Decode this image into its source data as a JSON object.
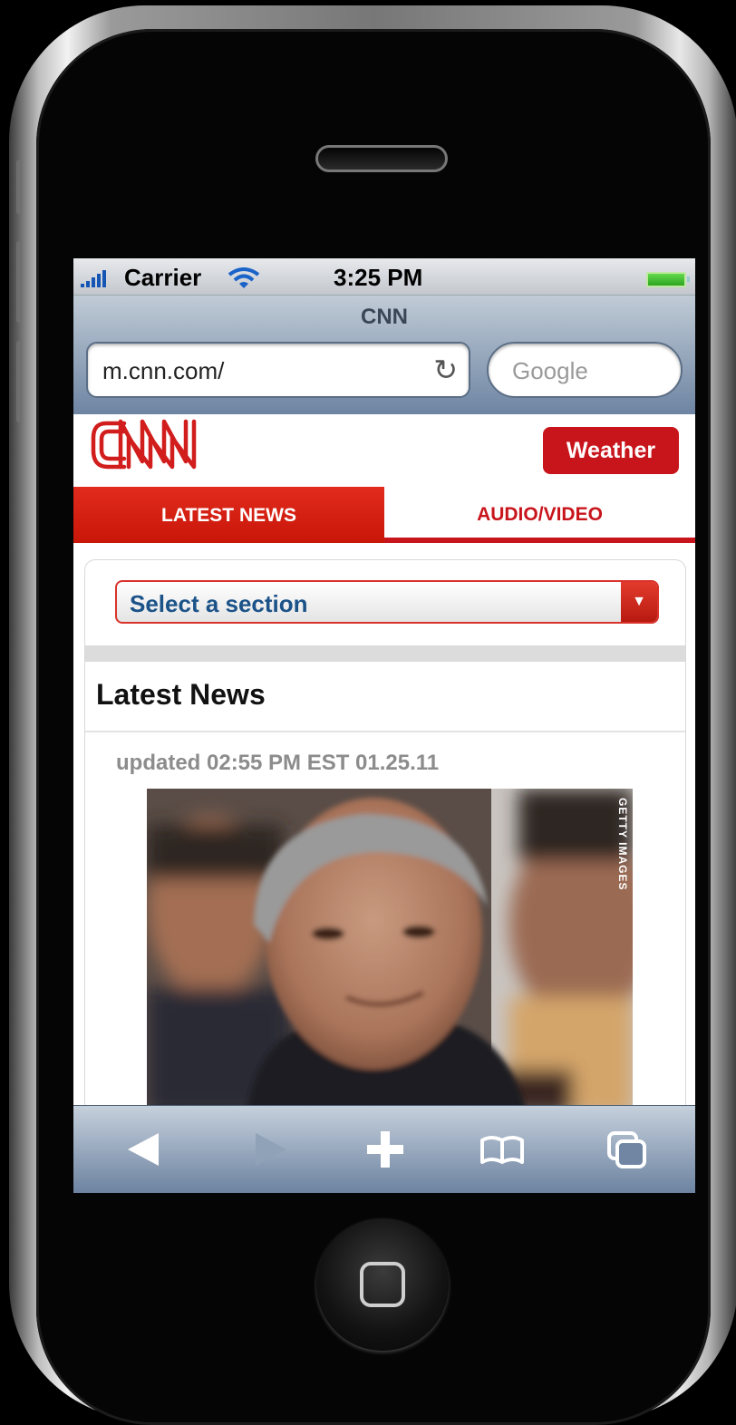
{
  "status_bar": {
    "carrier": "Carrier",
    "time": "3:25 PM",
    "signal_icon": "signal-bars-icon",
    "wifi_icon": "wifi-icon",
    "battery_icon": "battery-icon"
  },
  "browser": {
    "page_title": "CNN",
    "url": "m.cnn.com/",
    "search_placeholder": "Google",
    "reload_icon": "reload-icon"
  },
  "site": {
    "logo_text": "CNN",
    "weather_label": "Weather",
    "tabs": [
      {
        "label": "LATEST NEWS",
        "active": true
      },
      {
        "label": "AUDIO/VIDEO",
        "active": false
      }
    ],
    "section_select": "Select a section",
    "section_heading": "Latest News",
    "updated": "updated 02:55 PM EST 01.25.11",
    "photo_credit": "GETTY IMAGES"
  },
  "toolbar": {
    "icons": [
      "back-icon",
      "forward-icon",
      "add-icon",
      "bookmarks-icon",
      "pages-icon"
    ]
  },
  "colors": {
    "cnn_red": "#c8151c",
    "select_text": "#1b5389",
    "toolbar_blue": "#6c82a0"
  }
}
